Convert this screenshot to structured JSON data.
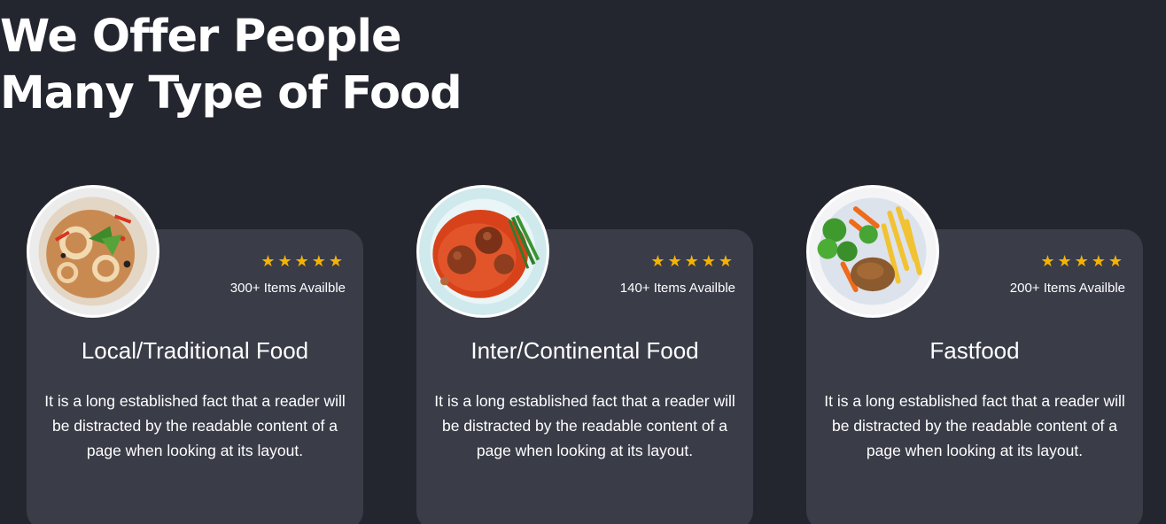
{
  "header": {
    "line1": "We Offer People",
    "line2": "Many Type of Food"
  },
  "cards": [
    {
      "stars": "★★★★★",
      "rating": 5,
      "items": "300+ Items Availble",
      "title": "Local/Traditional Food",
      "description": "It is a long established fact that a reader will be distracted by the readable content of a page when looking at its layout."
    },
    {
      "stars": "★★★★★",
      "rating": 5,
      "items": "140+ Items Availble",
      "title": "Inter/Continental Food",
      "description": "It is a long established fact that a reader will be distracted by the readable content of a page when looking at its layout."
    },
    {
      "stars": "★★★★★",
      "rating": 5,
      "items": "200+ Items Availble",
      "title": "Fastfood",
      "description": "It is a long established fact that a reader will be distracted by the readable content of a page when looking at its layout."
    }
  ],
  "colors": {
    "background": "#24262f",
    "card": "#3a3c48",
    "star": "#f5b301",
    "text": "#ffffff"
  }
}
